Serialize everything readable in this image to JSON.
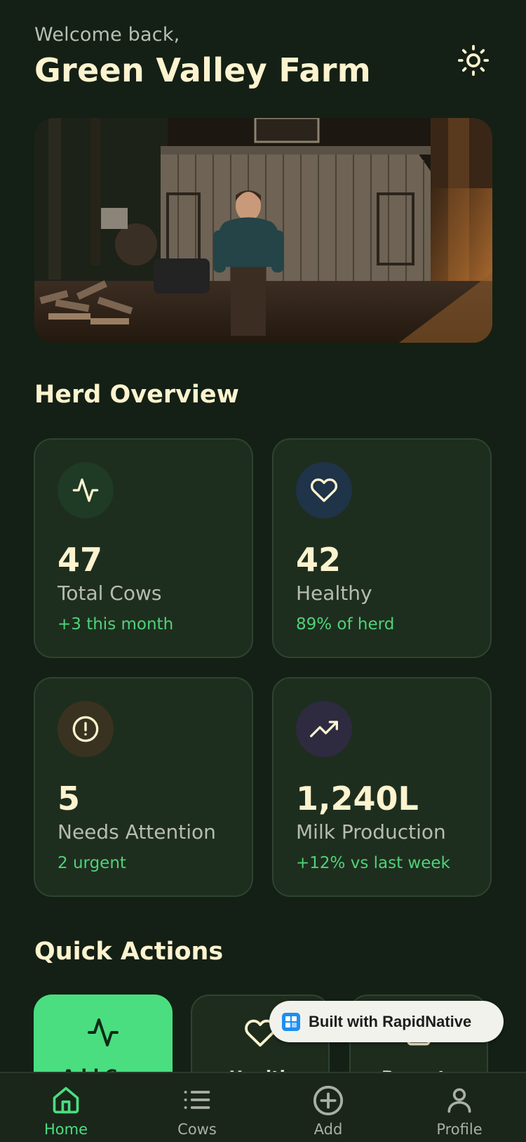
{
  "header": {
    "welcome": "Welcome back,",
    "farm_name": "Green Valley Farm",
    "theme_icon": "sun-icon"
  },
  "hero": {
    "image": "farmer-in-front-of-wooden-barn"
  },
  "herd_overview": {
    "title": "Herd Overview",
    "cards": [
      {
        "icon": "activity-icon",
        "value": "47",
        "label": "Total Cows",
        "sub": "+3 this month",
        "icon_bg": "#1f3a25",
        "icon_color": "#fdf3cf"
      },
      {
        "icon": "heart-icon",
        "value": "42",
        "label": "Healthy",
        "sub": "89% of herd",
        "icon_bg": "#1f3349",
        "icon_color": "#fdf3cf"
      },
      {
        "icon": "alert-circle-icon",
        "value": "5",
        "label": "Needs Attention",
        "sub": "2 urgent",
        "icon_bg": "#3a3220",
        "icon_color": "#fdf3cf"
      },
      {
        "icon": "trending-up-icon",
        "value": "1,240L",
        "label": "Milk Production",
        "sub": "+12% vs last week",
        "icon_bg": "#2e2a40",
        "icon_color": "#fdf3cf"
      }
    ]
  },
  "quick_actions": {
    "title": "Quick Actions",
    "items": [
      {
        "icon": "activity-icon",
        "label": "Add Cow"
      },
      {
        "icon": "heart-icon",
        "label": "Health"
      },
      {
        "icon": "report-icon",
        "label": "Reports"
      }
    ]
  },
  "badge": {
    "text": "Built with RapidNative"
  },
  "nav": {
    "items": [
      {
        "icon": "home-icon",
        "label": "Home",
        "active": true
      },
      {
        "icon": "list-icon",
        "label": "Cows",
        "active": false
      },
      {
        "icon": "plus-circle-icon",
        "label": "Add",
        "active": false
      },
      {
        "icon": "user-icon",
        "label": "Profile",
        "active": false
      }
    ]
  },
  "colors": {
    "background": "#142015",
    "card": "#1e2e1e",
    "accent": "#4ade80",
    "heading": "#fdf3cf"
  }
}
